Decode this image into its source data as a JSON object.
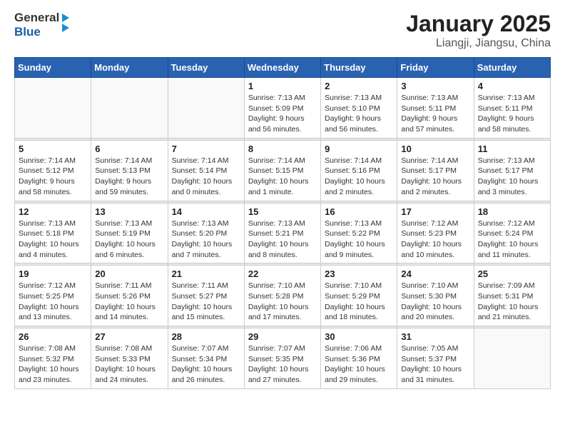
{
  "logo": {
    "line1": "General",
    "line2": "Blue",
    "aria": "GeneralBlue logo"
  },
  "title": "January 2025",
  "subtitle": "Liangji, Jiangsu, China",
  "weekdays": [
    "Sunday",
    "Monday",
    "Tuesday",
    "Wednesday",
    "Thursday",
    "Friday",
    "Saturday"
  ],
  "weeks": [
    [
      {
        "day": "",
        "sunrise": "",
        "sunset": "",
        "daylight": ""
      },
      {
        "day": "",
        "sunrise": "",
        "sunset": "",
        "daylight": ""
      },
      {
        "day": "",
        "sunrise": "",
        "sunset": "",
        "daylight": ""
      },
      {
        "day": "1",
        "sunrise": "Sunrise: 7:13 AM",
        "sunset": "Sunset: 5:09 PM",
        "daylight": "Daylight: 9 hours and 56 minutes."
      },
      {
        "day": "2",
        "sunrise": "Sunrise: 7:13 AM",
        "sunset": "Sunset: 5:10 PM",
        "daylight": "Daylight: 9 hours and 56 minutes."
      },
      {
        "day": "3",
        "sunrise": "Sunrise: 7:13 AM",
        "sunset": "Sunset: 5:11 PM",
        "daylight": "Daylight: 9 hours and 57 minutes."
      },
      {
        "day": "4",
        "sunrise": "Sunrise: 7:13 AM",
        "sunset": "Sunset: 5:11 PM",
        "daylight": "Daylight: 9 hours and 58 minutes."
      }
    ],
    [
      {
        "day": "5",
        "sunrise": "Sunrise: 7:14 AM",
        "sunset": "Sunset: 5:12 PM",
        "daylight": "Daylight: 9 hours and 58 minutes."
      },
      {
        "day": "6",
        "sunrise": "Sunrise: 7:14 AM",
        "sunset": "Sunset: 5:13 PM",
        "daylight": "Daylight: 9 hours and 59 minutes."
      },
      {
        "day": "7",
        "sunrise": "Sunrise: 7:14 AM",
        "sunset": "Sunset: 5:14 PM",
        "daylight": "Daylight: 10 hours and 0 minutes."
      },
      {
        "day": "8",
        "sunrise": "Sunrise: 7:14 AM",
        "sunset": "Sunset: 5:15 PM",
        "daylight": "Daylight: 10 hours and 1 minute."
      },
      {
        "day": "9",
        "sunrise": "Sunrise: 7:14 AM",
        "sunset": "Sunset: 5:16 PM",
        "daylight": "Daylight: 10 hours and 2 minutes."
      },
      {
        "day": "10",
        "sunrise": "Sunrise: 7:14 AM",
        "sunset": "Sunset: 5:17 PM",
        "daylight": "Daylight: 10 hours and 2 minutes."
      },
      {
        "day": "11",
        "sunrise": "Sunrise: 7:13 AM",
        "sunset": "Sunset: 5:17 PM",
        "daylight": "Daylight: 10 hours and 3 minutes."
      }
    ],
    [
      {
        "day": "12",
        "sunrise": "Sunrise: 7:13 AM",
        "sunset": "Sunset: 5:18 PM",
        "daylight": "Daylight: 10 hours and 4 minutes."
      },
      {
        "day": "13",
        "sunrise": "Sunrise: 7:13 AM",
        "sunset": "Sunset: 5:19 PM",
        "daylight": "Daylight: 10 hours and 6 minutes."
      },
      {
        "day": "14",
        "sunrise": "Sunrise: 7:13 AM",
        "sunset": "Sunset: 5:20 PM",
        "daylight": "Daylight: 10 hours and 7 minutes."
      },
      {
        "day": "15",
        "sunrise": "Sunrise: 7:13 AM",
        "sunset": "Sunset: 5:21 PM",
        "daylight": "Daylight: 10 hours and 8 minutes."
      },
      {
        "day": "16",
        "sunrise": "Sunrise: 7:13 AM",
        "sunset": "Sunset: 5:22 PM",
        "daylight": "Daylight: 10 hours and 9 minutes."
      },
      {
        "day": "17",
        "sunrise": "Sunrise: 7:12 AM",
        "sunset": "Sunset: 5:23 PM",
        "daylight": "Daylight: 10 hours and 10 minutes."
      },
      {
        "day": "18",
        "sunrise": "Sunrise: 7:12 AM",
        "sunset": "Sunset: 5:24 PM",
        "daylight": "Daylight: 10 hours and 11 minutes."
      }
    ],
    [
      {
        "day": "19",
        "sunrise": "Sunrise: 7:12 AM",
        "sunset": "Sunset: 5:25 PM",
        "daylight": "Daylight: 10 hours and 13 minutes."
      },
      {
        "day": "20",
        "sunrise": "Sunrise: 7:11 AM",
        "sunset": "Sunset: 5:26 PM",
        "daylight": "Daylight: 10 hours and 14 minutes."
      },
      {
        "day": "21",
        "sunrise": "Sunrise: 7:11 AM",
        "sunset": "Sunset: 5:27 PM",
        "daylight": "Daylight: 10 hours and 15 minutes."
      },
      {
        "day": "22",
        "sunrise": "Sunrise: 7:10 AM",
        "sunset": "Sunset: 5:28 PM",
        "daylight": "Daylight: 10 hours and 17 minutes."
      },
      {
        "day": "23",
        "sunrise": "Sunrise: 7:10 AM",
        "sunset": "Sunset: 5:29 PM",
        "daylight": "Daylight: 10 hours and 18 minutes."
      },
      {
        "day": "24",
        "sunrise": "Sunrise: 7:10 AM",
        "sunset": "Sunset: 5:30 PM",
        "daylight": "Daylight: 10 hours and 20 minutes."
      },
      {
        "day": "25",
        "sunrise": "Sunrise: 7:09 AM",
        "sunset": "Sunset: 5:31 PM",
        "daylight": "Daylight: 10 hours and 21 minutes."
      }
    ],
    [
      {
        "day": "26",
        "sunrise": "Sunrise: 7:08 AM",
        "sunset": "Sunset: 5:32 PM",
        "daylight": "Daylight: 10 hours and 23 minutes."
      },
      {
        "day": "27",
        "sunrise": "Sunrise: 7:08 AM",
        "sunset": "Sunset: 5:33 PM",
        "daylight": "Daylight: 10 hours and 24 minutes."
      },
      {
        "day": "28",
        "sunrise": "Sunrise: 7:07 AM",
        "sunset": "Sunset: 5:34 PM",
        "daylight": "Daylight: 10 hours and 26 minutes."
      },
      {
        "day": "29",
        "sunrise": "Sunrise: 7:07 AM",
        "sunset": "Sunset: 5:35 PM",
        "daylight": "Daylight: 10 hours and 27 minutes."
      },
      {
        "day": "30",
        "sunrise": "Sunrise: 7:06 AM",
        "sunset": "Sunset: 5:36 PM",
        "daylight": "Daylight: 10 hours and 29 minutes."
      },
      {
        "day": "31",
        "sunrise": "Sunrise: 7:05 AM",
        "sunset": "Sunset: 5:37 PM",
        "daylight": "Daylight: 10 hours and 31 minutes."
      },
      {
        "day": "",
        "sunrise": "",
        "sunset": "",
        "daylight": ""
      }
    ]
  ]
}
